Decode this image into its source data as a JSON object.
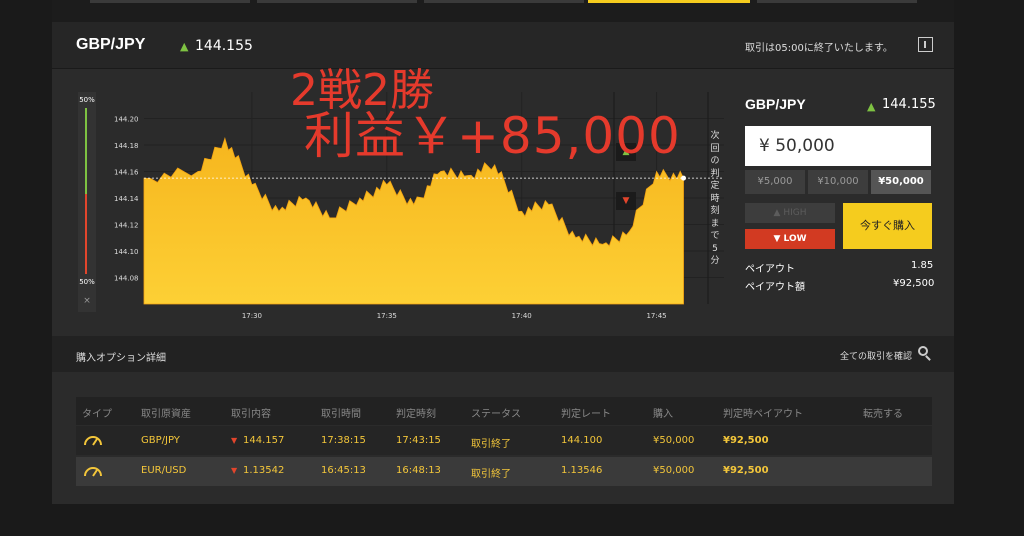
{
  "header": {
    "pair": "GBP/JPY",
    "price": "144.155",
    "notice": "取引は05:00に終了いたします。"
  },
  "overlay": {
    "line1": "2戦2勝",
    "line2": "利益￥+85,000"
  },
  "sidebar": {
    "top": "50%",
    "bottom": "50%",
    "close": "×"
  },
  "chart_data": {
    "type": "area",
    "yticks": [
      "144.20",
      "144.18",
      "144.16",
      "144.14",
      "144.12",
      "144.10",
      "144.08"
    ],
    "xticks": [
      "17:30",
      "17:35",
      "17:40",
      "17:45"
    ],
    "ylim": [
      144.06,
      144.22
    ],
    "current_rate": 144.155,
    "countdown_label": "次回の判定時刻まで5分",
    "series": [
      {
        "x": [
          "17:26",
          "17:28",
          "17:29",
          "17:30",
          "17:31",
          "17:32",
          "17:33",
          "17:34",
          "17:35",
          "17:36",
          "17:37",
          "17:38",
          "17:39",
          "17:40",
          "17:41",
          "17:42",
          "17:43",
          "17:44",
          "17:45",
          "17:46"
        ],
        "values": [
          144.155,
          144.16,
          144.185,
          144.15,
          144.13,
          144.14,
          144.125,
          144.14,
          144.15,
          144.135,
          144.16,
          144.157,
          144.165,
          144.13,
          144.135,
          144.11,
          144.105,
          144.115,
          144.16,
          144.155
        ]
      }
    ]
  },
  "trade": {
    "pair": "GBP/JPY",
    "price": "144.155",
    "amount": "¥ 50,000",
    "amount_options": [
      "¥5,000",
      "¥10,000",
      "¥50,000"
    ],
    "high_label": "HIGH",
    "low_label": "LOW",
    "buy_label": "今すぐ購入",
    "payout_label": "ペイアウト",
    "payout_value": "1.85",
    "payout_amount_label": "ペイアウト額",
    "payout_amount_value": "¥92,500"
  },
  "details": {
    "title": "購入オプション詳細",
    "confirm_all": "全ての取引を確認",
    "columns": [
      "タイプ",
      "取引原資産",
      "取引内容",
      "取引時間",
      "判定時刻",
      "ステータス",
      "判定レート",
      "購入",
      "判定時ペイアウト",
      "転売する"
    ],
    "rows": [
      {
        "asset": "GBP/JPY",
        "content": "144.157",
        "time": "17:38:15",
        "judge": "17:43:15",
        "status": "取引終了",
        "rate": "144.100",
        "buy": "¥50,000",
        "payout": "¥92,500"
      },
      {
        "asset": "EUR/USD",
        "content": "1.13542",
        "time": "16:45:13",
        "judge": "16:48:13",
        "status": "取引終了",
        "rate": "1.13546",
        "buy": "¥50,000",
        "payout": "¥92,500"
      }
    ]
  },
  "colors": {
    "accent": "#f5cc1e",
    "low": "#d23a22",
    "high": "#7ec242",
    "overlay": "#e53a2c"
  }
}
